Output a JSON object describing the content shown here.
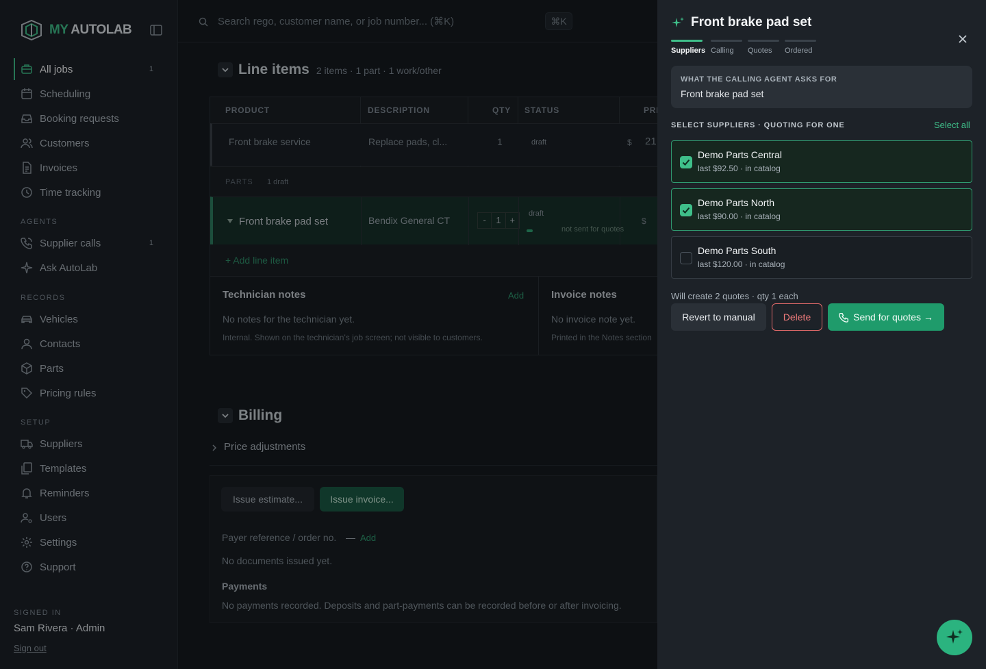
{
  "brand": {
    "my": "MY",
    "auto": "AUTOLAB"
  },
  "sidebar": {
    "items": [
      {
        "label": "All jobs",
        "count": "1"
      },
      {
        "label": "Scheduling"
      },
      {
        "label": "Booking requests"
      },
      {
        "label": "Customers"
      },
      {
        "label": "Invoices"
      },
      {
        "label": "Time tracking"
      }
    ],
    "agents_label": "AGENTS",
    "agents": [
      {
        "label": "Supplier calls",
        "count": "1"
      },
      {
        "label": "Ask AutoLab"
      }
    ],
    "records_label": "RECORDS",
    "records": [
      {
        "label": "Vehicles"
      },
      {
        "label": "Contacts"
      },
      {
        "label": "Parts"
      },
      {
        "label": "Pricing rules"
      }
    ],
    "setup_label": "SETUP",
    "setup": [
      {
        "label": "Suppliers"
      },
      {
        "label": "Templates"
      },
      {
        "label": "Reminders"
      },
      {
        "label": "Users"
      },
      {
        "label": "Settings"
      },
      {
        "label": "Support"
      }
    ],
    "signed_in_label": "SIGNED IN",
    "user": "Sam Rivera · Admin",
    "sign_out": "Sign out"
  },
  "search": {
    "placeholder": "Search rego, customer name, or job number... (⌘K)",
    "shortcut": "⌘K"
  },
  "line_items": {
    "title": "Line items",
    "summary": "2 items · 1 part · 1 work/other",
    "columns": {
      "product": "PRODUCT",
      "description": "DESCRIPTION",
      "qty": "QTY",
      "status": "STATUS",
      "price": "PRI"
    },
    "row1": {
      "product": "Front brake service",
      "description": "Replace pads, cl...",
      "qty": "1",
      "status": "draft",
      "currency": "$",
      "price": "21"
    },
    "parts_label": "PARTS",
    "parts_count": "1 draft",
    "row2": {
      "product": "Front brake pad set",
      "description": "Bendix General CT",
      "qty": "1",
      "minus": "-",
      "plus": "+",
      "status": "draft",
      "quote_status": "not sent for quotes",
      "currency": "$"
    },
    "add_item": "+ Add line item",
    "tech_notes": {
      "title": "Technician notes",
      "add": "Add",
      "empty": "No notes for the technician yet.",
      "hint": "Internal. Shown on the technician's job screen; not visible to customers."
    },
    "invoice_notes": {
      "title": "Invoice notes",
      "empty": "No invoice note yet.",
      "hint": "Printed in the Notes section"
    }
  },
  "billing": {
    "title": "Billing",
    "price_adjustments": "Price adjustments",
    "issue_estimate": "Issue estimate...",
    "issue_invoice": "Issue invoice...",
    "payer_ref_label": "Payer reference / order no.",
    "payer_ref_value": "—",
    "payer_ref_add": "Add",
    "no_docs": "No documents issued yet.",
    "payments_title": "Payments",
    "payments_empty": "No payments recorded. Deposits and part-payments can be recorded before or after invoicing."
  },
  "drawer": {
    "title": "Front brake pad set",
    "steps": [
      "Suppliers",
      "Calling",
      "Quotes",
      "Ordered"
    ],
    "active_step": "Suppliers",
    "ask_label": "WHAT THE CALLING AGENT ASKS FOR",
    "ask_value": "Front brake pad set",
    "select_heading": "SELECT SUPPLIERS · QUOTING FOR ONE",
    "select_all": "Select all",
    "suppliers": [
      {
        "name": "Demo Parts Central",
        "meta": "last $92.50 · in catalog",
        "checked": true
      },
      {
        "name": "Demo Parts North",
        "meta": "last $90.00 · in catalog",
        "checked": true
      },
      {
        "name": "Demo Parts South",
        "meta": "last $120.00 · in catalog",
        "checked": false
      }
    ],
    "summary": "Will create 2 quotes · qty 1 each",
    "revert": "Revert to manual",
    "delete": "Delete",
    "send": "Send for quotes →"
  },
  "colors": {
    "accent": "#3fbf8a",
    "danger": "#e36a6a",
    "panel": "#1d2228"
  },
  "icons": [
    "logo-mark-icon",
    "sidebar-toggle-icon",
    "briefcase-icon",
    "calendar-icon",
    "inbox-icon",
    "users-icon",
    "file-icon",
    "clock-icon",
    "phone-icon",
    "sparkle-icon",
    "car-icon",
    "user-icon",
    "box-icon",
    "tag-icon",
    "truck-icon",
    "template-icon",
    "bell-icon",
    "users-cog-icon",
    "gear-icon",
    "help-icon",
    "search-icon",
    "chevron-down-icon",
    "chevron-right-icon",
    "close-icon"
  ]
}
